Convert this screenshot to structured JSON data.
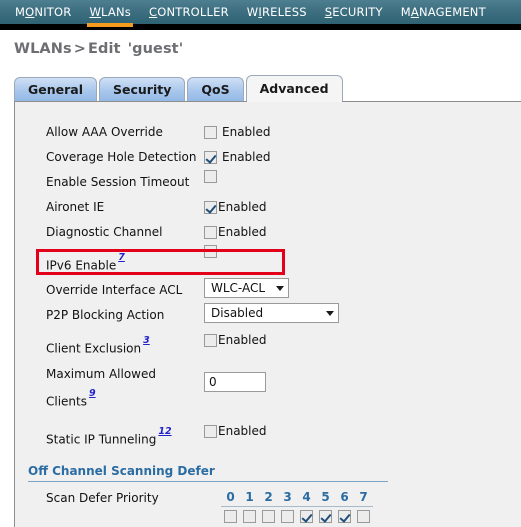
{
  "nav": {
    "items": [
      {
        "pre": "M",
        "key": "O",
        "post": "NITOR",
        "label": "MONITOR",
        "active": false
      },
      {
        "pre": "",
        "key": "W",
        "post": "LANs",
        "label": "WLANs",
        "active": true
      },
      {
        "pre": "",
        "key": "C",
        "post": "ONTROLLER",
        "label": "CONTROLLER",
        "active": false
      },
      {
        "pre": "W",
        "key": "I",
        "post": "RELESS",
        "label": "WIRELESS",
        "active": false
      },
      {
        "pre": "",
        "key": "S",
        "post": "ECURITY",
        "label": "SECURITY",
        "active": false
      },
      {
        "pre": "M",
        "key": "A",
        "post": "NAGEMENT",
        "label": "MANAGEMENT",
        "active": false
      }
    ],
    "active_accent": "#f59b1e"
  },
  "title": {
    "root": "WLANs",
    "separator": ">",
    "action": "Edit",
    "object": "'guest'"
  },
  "tabs": [
    {
      "label": "General",
      "active": false
    },
    {
      "label": "Security",
      "active": false
    },
    {
      "label": "QoS",
      "active": false
    },
    {
      "label": "Advanced",
      "active": true
    }
  ],
  "form": {
    "allow_aaa_override": {
      "label": "Allow AAA Override",
      "checkbox_label": "Enabled",
      "checked": false
    },
    "coverage_hole_detection": {
      "label": "Coverage Hole Detection",
      "checkbox_label": "Enabled",
      "checked": true
    },
    "enable_session_timeout": {
      "label": "Enable Session Timeout",
      "checkbox_label": "",
      "checked": false
    },
    "aironet_ie": {
      "label": "Aironet IE",
      "checkbox_label": "Enabled",
      "checked": true
    },
    "diagnostic_channel": {
      "label": "Diagnostic Channel",
      "checkbox_label": "Enabled",
      "checked": false
    },
    "ipv6_enable": {
      "label": "IPv6 Enable",
      "note": "7",
      "checkbox_label": "",
      "checked": false
    },
    "override_interface_acl": {
      "label": "Override Interface ACL",
      "value": "WLC-ACL",
      "highlighted": true,
      "highlight_color": "#e3001b"
    },
    "p2p_blocking_action": {
      "label": "P2P Blocking Action",
      "value": "Disabled"
    },
    "client_exclusion": {
      "label": "Client Exclusion",
      "note": "3",
      "checkbox_label": "Enabled",
      "checked": false
    },
    "maximum_allowed_clients": {
      "label_line1": "Maximum Allowed",
      "label_line2": "Clients",
      "note": "9",
      "value": "0"
    },
    "static_ip_tunneling": {
      "label": "Static IP Tunneling",
      "note": "12",
      "checkbox_label": "Enabled",
      "checked": false
    }
  },
  "off_channel": {
    "section_title": "Off Channel Scanning Defer",
    "scan_defer_label": "Scan Defer Priority",
    "priorities": [
      {
        "num": "0",
        "checked": false
      },
      {
        "num": "1",
        "checked": false
      },
      {
        "num": "2",
        "checked": false
      },
      {
        "num": "3",
        "checked": false
      },
      {
        "num": "4",
        "checked": true
      },
      {
        "num": "5",
        "checked": true
      },
      {
        "num": "6",
        "checked": true
      },
      {
        "num": "7",
        "checked": false
      }
    ]
  }
}
